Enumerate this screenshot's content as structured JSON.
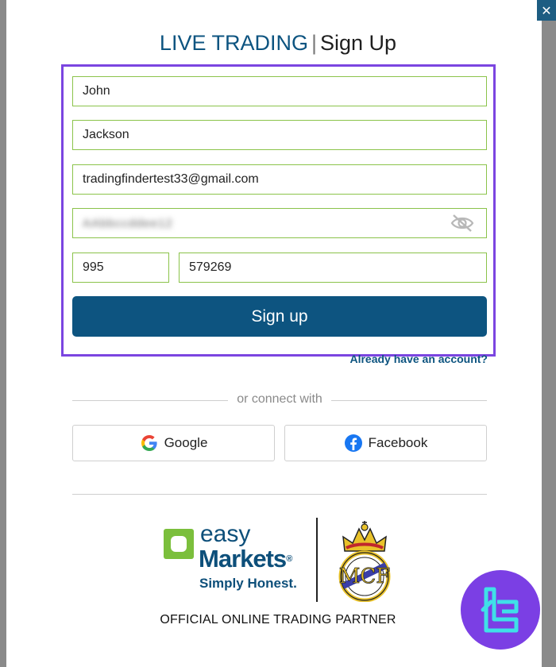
{
  "window": {
    "close_glyph": "✕"
  },
  "header": {
    "title_live": "LIVE TRADING",
    "title_separator": "|",
    "title_signup": "Sign Up"
  },
  "form": {
    "first_name": "John",
    "last_name": "Jackson",
    "email": "tradingfindertest33@gmail.com",
    "password_blurred": "AAbbccddee12",
    "phone_code": "995",
    "phone_number": "579269",
    "signup_label": "Sign up",
    "already_link": "Already have an account?"
  },
  "social": {
    "connect_text": "or connect with",
    "google_label": "Google",
    "facebook_label": "Facebook"
  },
  "footer": {
    "brand_easy": "easy",
    "brand_markets": "Markets",
    "brand_reg": "®",
    "brand_tagline": "Simply Honest.",
    "partner_text": "OFFICIAL ONLINE TRADING PARTNER"
  },
  "colors": {
    "primary": "#0d5480",
    "field_border": "#8bc34a",
    "highlight": "#7b45e0",
    "brand_green": "#7bbf3c",
    "watermark": "#7b3fe4"
  }
}
